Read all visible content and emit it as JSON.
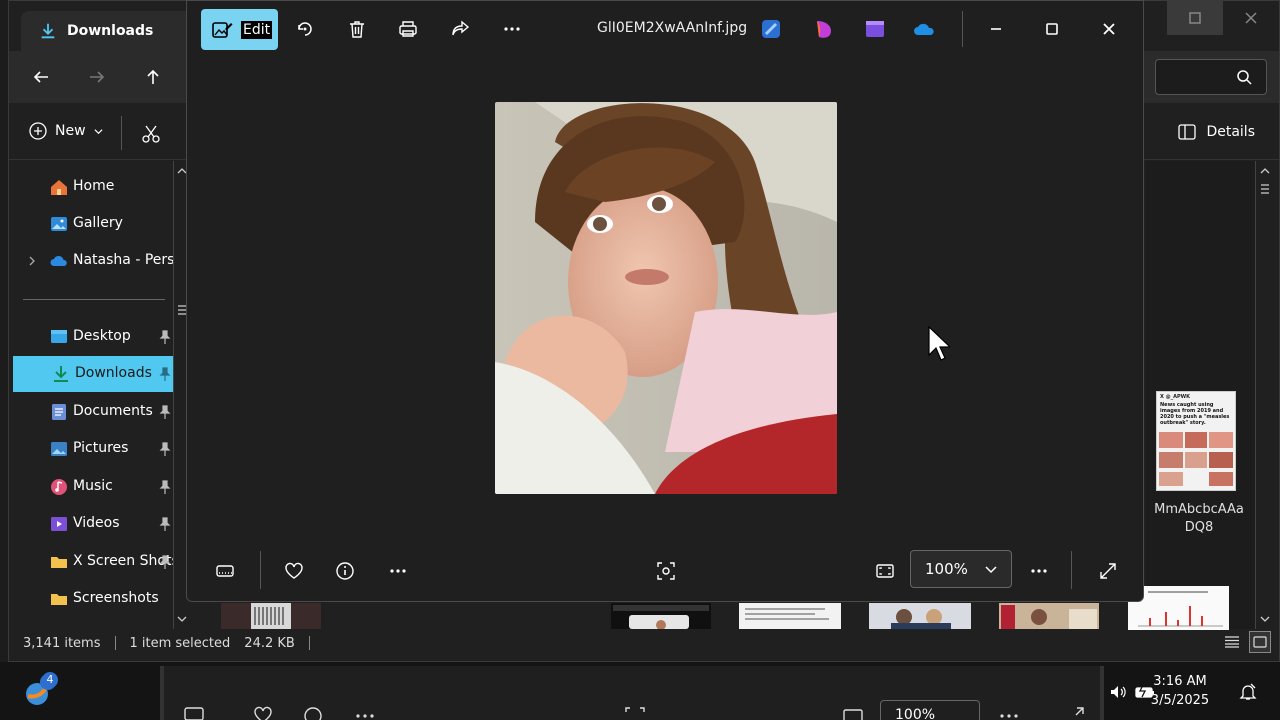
{
  "explorer": {
    "tab_title": "Downloads",
    "new_label": "New",
    "details_label": "Details",
    "sidebar": {
      "items": [
        {
          "label": "Home"
        },
        {
          "label": "Gallery"
        },
        {
          "label": "Natasha - Personal"
        },
        {
          "label": "Desktop"
        },
        {
          "label": "Downloads"
        },
        {
          "label": "Documents"
        },
        {
          "label": "Pictures"
        },
        {
          "label": "Music"
        },
        {
          "label": "Videos"
        },
        {
          "label": "X Screen Shots"
        },
        {
          "label": "Screenshots"
        }
      ]
    },
    "thumbnail": {
      "caption_line1": "MmAbcbcAAa",
      "caption_line2": "DQ8",
      "doc_header": "X @_APWK",
      "doc_text": "News caught using images from 2019 and 2020 to push a \"measles outbreak\" story."
    },
    "status": {
      "items_count": "3,141 items",
      "selected": "1 item selected",
      "size": "24.2 KB"
    }
  },
  "photos": {
    "edit_label": "Edit",
    "file_name": "GlI0EM2XwAAnInf.jpg",
    "zoom": "100%"
  },
  "ghost": {
    "zoom": "100%"
  },
  "taskbar": {
    "badge": "4",
    "time": "3:16 AM",
    "date": "3/5/2025"
  },
  "colors": {
    "accent": "#50c8f0",
    "edit_button": "#7ad3f0"
  }
}
